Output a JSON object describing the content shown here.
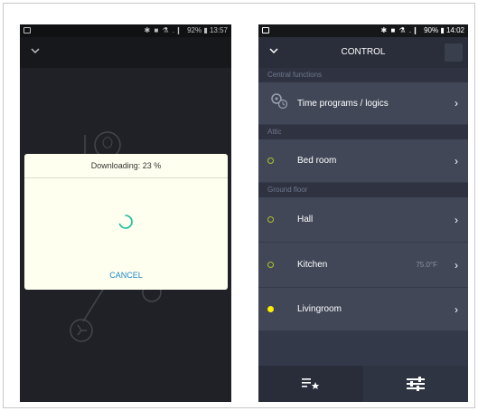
{
  "left_phone": {
    "status_bar": {
      "icons": "✱ ■ ⚗ .❙",
      "battery": "92%",
      "time": "13:57"
    },
    "dialog": {
      "title": "Downloading: 23 %",
      "cancel_label": "CANCEL"
    }
  },
  "right_phone": {
    "status_bar": {
      "icons": "✱ ■ ⚗ .❙",
      "battery": "90%",
      "time": "14:02"
    },
    "header": {
      "title": "CONTROL"
    },
    "sections": [
      {
        "label": "Central functions"
      },
      {
        "label": "Attic"
      },
      {
        "label": "Ground floor"
      }
    ],
    "rows": [
      {
        "label": "Time programs / logics",
        "icon": "gear-clock-icon"
      },
      {
        "label": "Bed room",
        "indicator": "ring"
      },
      {
        "label": "Hall",
        "indicator": "ring"
      },
      {
        "label": "Kitchen",
        "indicator": "ring",
        "value": "75.0°F"
      },
      {
        "label": "Livingroom",
        "indicator": "fill"
      }
    ],
    "tabs": [
      {
        "name": "favorites",
        "icon": "list-star-icon"
      },
      {
        "name": "controls",
        "icon": "sliders-icon",
        "active": true
      }
    ]
  },
  "colors": {
    "accent": "#1f88c9",
    "spinner": "#1abc9c",
    "indicator_ring": "#b3c32a",
    "indicator_fill": "#ffee00"
  }
}
